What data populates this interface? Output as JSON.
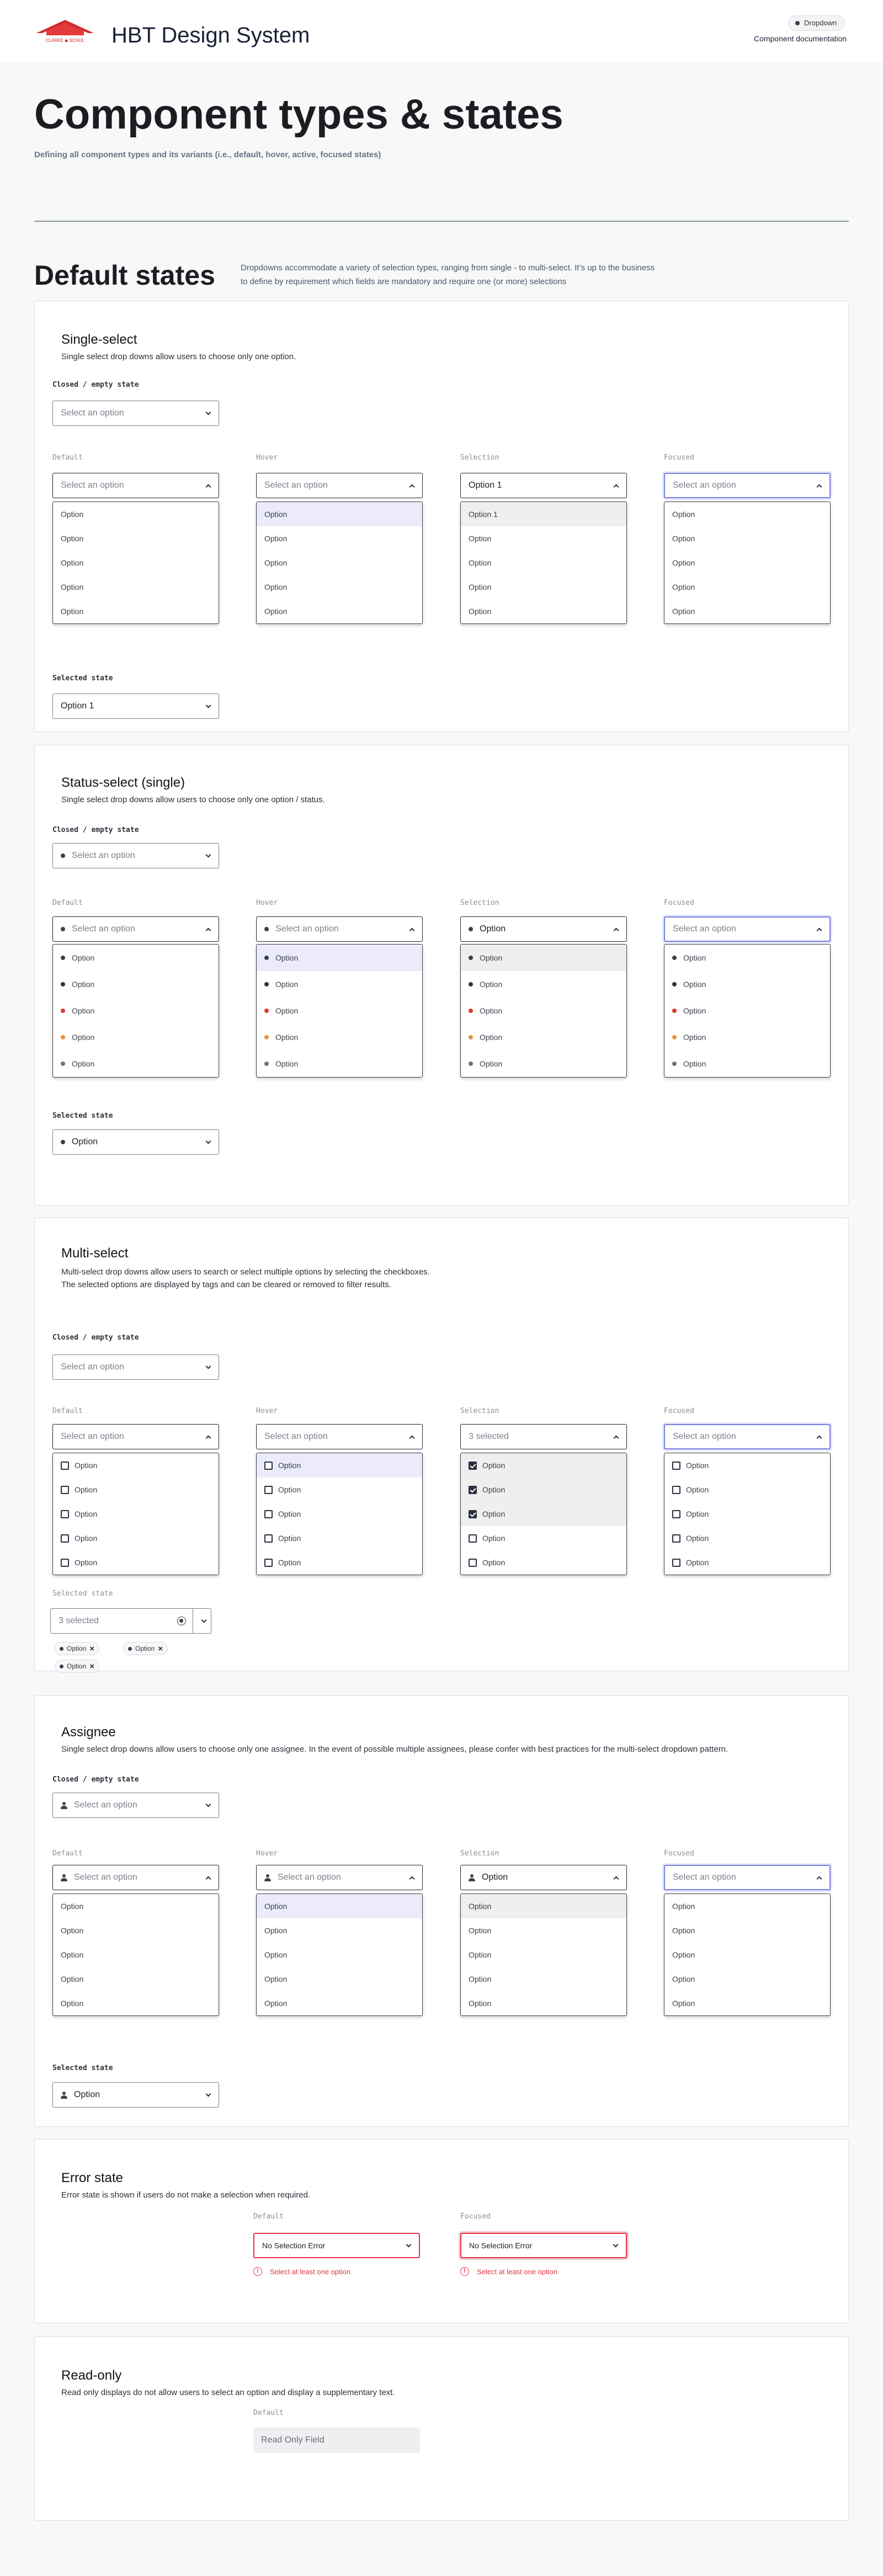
{
  "header": {
    "brand": "HBT Design System",
    "pill": "Dropdown",
    "link": "Component documentation",
    "logo_text": "CLARKE ◆ SCHOL"
  },
  "page": {
    "title": "Component types & states",
    "subtitle": "Defining all component types and its variants (i.e., default, hover, active, focused states)"
  },
  "section": {
    "title": "Default states",
    "desc": "Dropdowns accommodate a variety of selection types, ranging from single - to multi-select. It’s up to the business to define by requirement which fields are mandatory and require one (or more) selections"
  },
  "labels": {
    "closed": "Closed / empty state",
    "default": "Default",
    "hover": "Hover",
    "selection": "Selection",
    "focused": "Focused",
    "selected": "Selected state"
  },
  "colors": {
    "status": [
      "#3a3f4d",
      "#2e3340",
      "#e03a2f",
      "#ee8f3a",
      "#6b7280"
    ],
    "focus": "#7a7fe0",
    "error": "#e03444"
  },
  "single": {
    "title": "Single-select",
    "desc": "Single select drop downs allow users to choose only one option.",
    "placeholder": "Select an option",
    "selection_value": "Option 1",
    "menu": [
      "Option",
      "Option",
      "Option",
      "Option",
      "Option"
    ],
    "selection_menu": [
      "Option 1",
      "Option",
      "Option",
      "Option",
      "Option"
    ],
    "selected_value": "Option 1"
  },
  "status": {
    "title": "Status-select (single)",
    "desc": "Single select drop downs allow users to choose only one option / status.",
    "placeholder": "Select an option",
    "selection_value": "Option",
    "menu": [
      "Option",
      "Option",
      "Option",
      "Option",
      "Option"
    ],
    "selected_value": "Option"
  },
  "multi": {
    "title": "Multi-select",
    "desc1": "Multi-select drop downs allow users to search or select multiple options by selecting the checkboxes.",
    "desc2": "The selected options are displayed by tags and can be cleared or removed to filter results.",
    "placeholder": "Select an option",
    "selection_value": "3 selected",
    "menu": [
      "Option",
      "Option",
      "Option",
      "Option",
      "Option"
    ],
    "selected_value": "3 selected",
    "tags": [
      "Option",
      "Option",
      "Option"
    ]
  },
  "assignee": {
    "title": "Assignee",
    "desc": "Single select drop downs allow users to choose only one assignee. In the event of possible multiple assignees, please confer with best practices for the multi-select dropdown pattern.",
    "placeholder": "Select an option",
    "selection_value": "Option",
    "menu": [
      "Option",
      "Option",
      "Option",
      "Option",
      "Option"
    ],
    "selected_value": "Option"
  },
  "error": {
    "title": "Error state",
    "desc": "Error state is shown if users do not make a selection when required.",
    "value": "No Selection Error",
    "message": "Select at least one option"
  },
  "readonly": {
    "title": "Read-only",
    "desc": "Read only displays do not allow users to select an option and display a supplementary text.",
    "value": "Read Only Field"
  }
}
